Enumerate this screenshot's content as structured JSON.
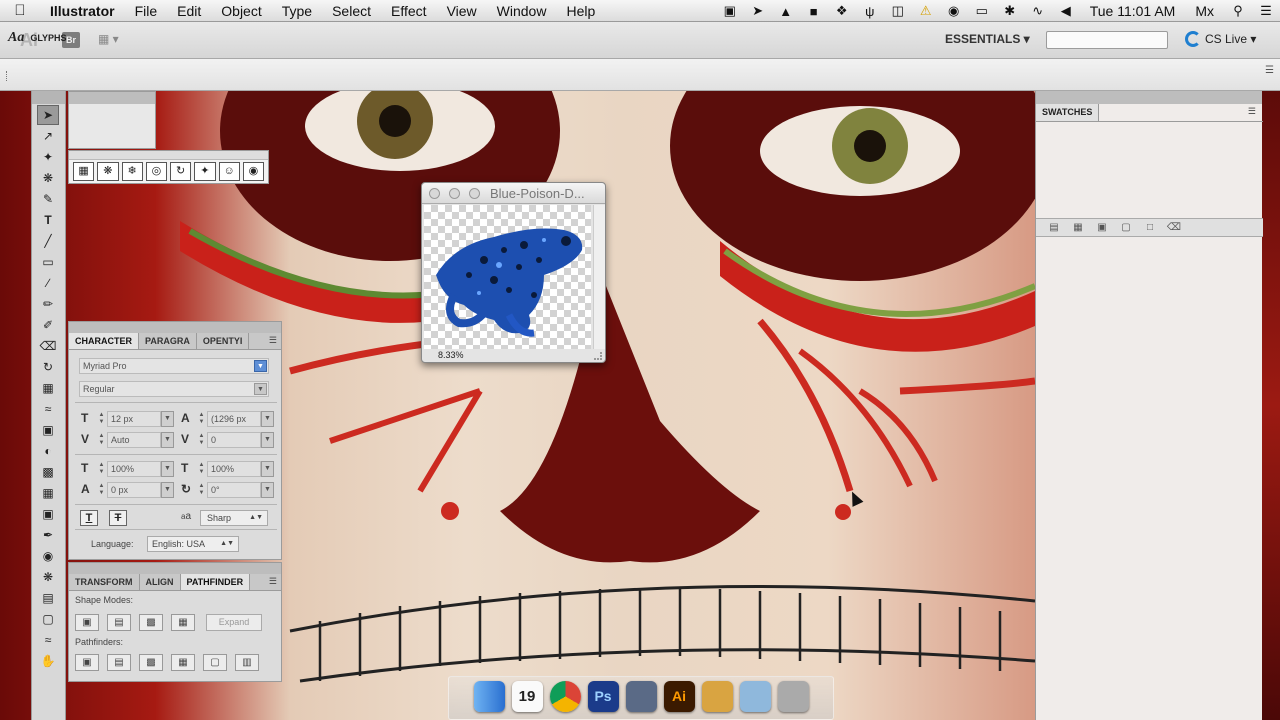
{
  "menubar": {
    "app_name": "Illustrator",
    "items": [
      "File",
      "Edit",
      "Object",
      "Type",
      "Select",
      "Effect",
      "View",
      "Window",
      "Help"
    ],
    "clock": "Tue 11:01 AM",
    "user": "Mx"
  },
  "appbar": {
    "logo": "Ai",
    "bridge_label": "Br",
    "workspace_label": "ESSENTIALS ▾",
    "search_placeholder": "",
    "cslive_label": "CS Live ▾"
  },
  "glyphs_panel": {
    "icon_text": "Aa",
    "title": "GLYPHS"
  },
  "character_panel": {
    "tabs": [
      "CHARACTER",
      "PARAGRA",
      "OPENTYI"
    ],
    "font_family": "Myriad Pro",
    "font_style": "Regular",
    "font_size": "12 px",
    "leading": "(1296 px",
    "kerning": "Auto",
    "tracking": "0",
    "vertical_scale": "100%",
    "horizontal_scale": "100%",
    "baseline_shift": "0 px",
    "rotation": "0°",
    "aa_label": "a",
    "antialiasing": "Sharp",
    "language_label": "Language:",
    "language": "English: USA"
  },
  "pathfinder_panel": {
    "tabs": [
      "TRANSFORM",
      "ALIGN",
      "PATHFINDER"
    ],
    "shape_modes_label": "Shape Modes:",
    "expand_label": "Expand",
    "pathfinders_label": "Pathfinders:"
  },
  "image_window": {
    "title": "Blue-Poison-D...",
    "zoom": "8.33%"
  },
  "swatches_panel": {
    "tab_label": "SWATCHES"
  },
  "dock": {
    "items": [
      {
        "name": "finder",
        "label": ""
      },
      {
        "name": "ical",
        "label": "19"
      },
      {
        "name": "chrome",
        "label": ""
      },
      {
        "name": "photoshop",
        "label": "Ps"
      },
      {
        "name": "imovie",
        "label": ""
      },
      {
        "name": "illustrator",
        "label": "Ai"
      },
      {
        "name": "apps",
        "label": ""
      },
      {
        "name": "folder",
        "label": ""
      },
      {
        "name": "trash",
        "label": ""
      }
    ]
  },
  "colors": {
    "illustrator_orange": "#ff9a00",
    "photoshop_blue": "#1b3b8a",
    "selection_blue": "#5e8fd6"
  }
}
